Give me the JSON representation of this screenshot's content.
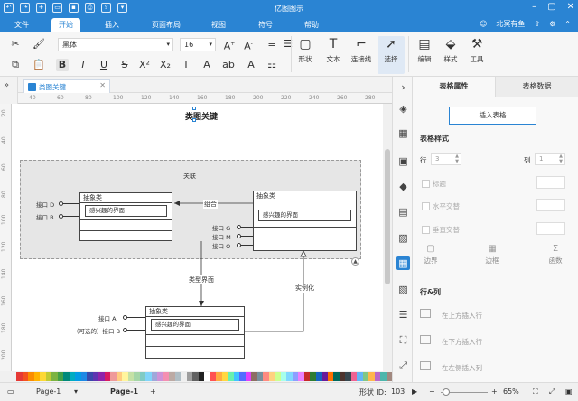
{
  "app": {
    "title": "亿图图示"
  },
  "menu": {
    "items": [
      "文件",
      "开始",
      "插入",
      "页面布局",
      "视图",
      "符号",
      "帮助"
    ],
    "active_index": 1,
    "user": "北冥有鱼"
  },
  "ribbon": {
    "font_name": "黑体",
    "font_size": "16",
    "tools": {
      "shape": "形状",
      "text": "文本",
      "connector": "连接线",
      "select": "选择",
      "edit": "编辑",
      "style": "样式",
      "tools": "工具"
    }
  },
  "document": {
    "tab_name": "类图关键"
  },
  "ruler": {
    "top": [
      "40",
      "60",
      "80",
      "100",
      "120",
      "140",
      "160",
      "180",
      "200",
      "220",
      "240",
      "260",
      "280"
    ],
    "left": [
      "20",
      "40",
      "60",
      "80",
      "100",
      "120",
      "140",
      "160",
      "180",
      "200"
    ]
  },
  "diagram": {
    "title": "类图关键",
    "group_label": "关联",
    "class_left": {
      "header": "抽象类",
      "row": "感兴趣的界面",
      "ports": [
        "接口 D",
        "接口 B"
      ]
    },
    "class_right": {
      "header": "抽象类",
      "row": "感兴趣的界面",
      "ports": [
        "接口 G",
        "接口 M",
        "接口 O"
      ]
    },
    "class_bottom": {
      "header": "抽象类",
      "row": "感兴趣的界面",
      "ports": [
        "接口 A",
        "（可选的）接口 B"
      ]
    },
    "edge_labels": {
      "composition": "组合",
      "interface_type": "类型界面",
      "instantiation": "实例化"
    }
  },
  "panel": {
    "tabs": [
      "表格属性",
      "表格数据"
    ],
    "insert_button": "插入表格",
    "table_style_title": "表格样式",
    "row_label": "行",
    "row_value": "3",
    "col_label": "列",
    "col_value": "1",
    "checks": [
      "标题",
      "水平交替",
      "垂直交替"
    ],
    "tools": [
      "边界",
      "边框",
      "函数"
    ],
    "row_col_title": "行&列",
    "row_actions": [
      "在上方插入行",
      "在下方插入行",
      "在左侧插入列"
    ]
  },
  "statusbar": {
    "page_tab": "Page-1",
    "page_active": "Page-1",
    "shape_id": "形状 ID:",
    "shape_id_value": "103",
    "zoom": "65%"
  },
  "palette": [
    "#e53935",
    "#f4511e",
    "#fb8c00",
    "#ffb300",
    "#fdd835",
    "#c0ca33",
    "#7cb342",
    "#43a047",
    "#00897b",
    "#00acc1",
    "#039be5",
    "#1e88e5",
    "#3949ab",
    "#5e35b1",
    "#8e24aa",
    "#d81b60",
    "#ef9a9a",
    "#ffcc80",
    "#fff59d",
    "#c5e1a5",
    "#a5d6a7",
    "#80cbc4",
    "#81d4fa",
    "#9fa8da",
    "#ce93d8",
    "#f48fb1",
    "#bcaaa4",
    "#b0bec5",
    "#eeeeee",
    "#9e9e9e",
    "#616161",
    "#212121",
    "#ffffff",
    "#ff5252",
    "#ffab40",
    "#ffd740",
    "#69f0ae",
    "#40c4ff",
    "#536dfe",
    "#e040fb",
    "#8d6e63",
    "#78909c",
    "#ff8a80",
    "#ffd180",
    "#ccff90",
    "#a7ffeb",
    "#80d8ff",
    "#8c9eff",
    "#ea80fc",
    "#c62828",
    "#2e7d32",
    "#1565c0",
    "#6a1b9a",
    "#ff6f00",
    "#00695c",
    "#4e342e",
    "#37474f",
    "#f06292",
    "#64b5f6",
    "#81c784",
    "#ffb74d",
    "#ba68c8",
    "#4db6ac",
    "#a1887f"
  ]
}
